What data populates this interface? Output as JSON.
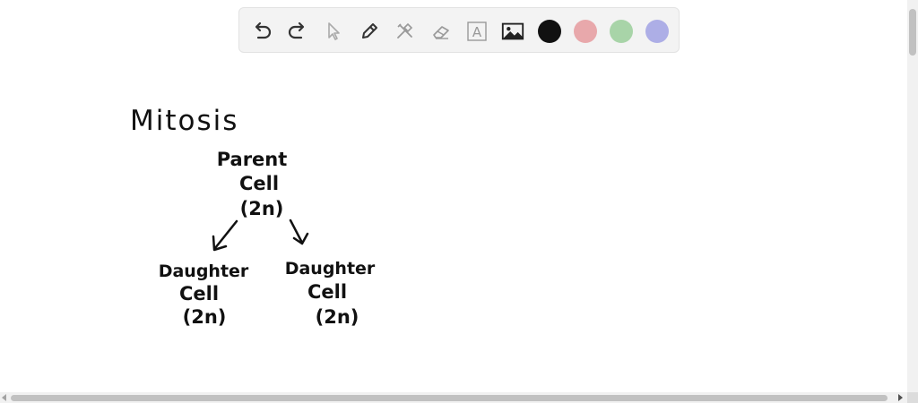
{
  "toolbar": {
    "tools": [
      {
        "name": "undo-icon"
      },
      {
        "name": "redo-icon"
      },
      {
        "name": "select-pointer-icon"
      },
      {
        "name": "pen-icon"
      },
      {
        "name": "tools-icon"
      },
      {
        "name": "eraser-icon"
      },
      {
        "name": "text-tool-icon",
        "glyph": "A"
      },
      {
        "name": "image-icon"
      }
    ],
    "colors": [
      "#111111",
      "#e8a8ab",
      "#a8d4a8",
      "#adaee6"
    ]
  },
  "drawing": {
    "title": "Mitosis",
    "parent": {
      "line1": "Parent",
      "line2": "Cell",
      "line3": "(2n)"
    },
    "left_child": {
      "line1": "Daughter",
      "line2": "Cell",
      "line3": "(2n)"
    },
    "right_child": {
      "line1": "Daughter",
      "line2": "Cell",
      "line3": "(2n)"
    }
  }
}
